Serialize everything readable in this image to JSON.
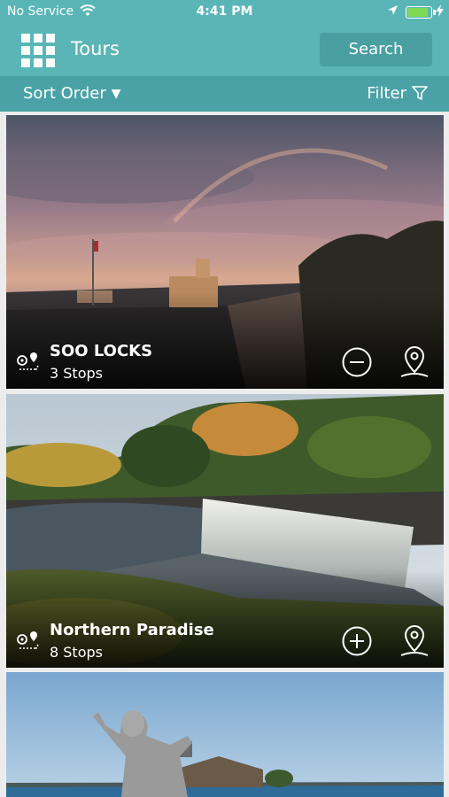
{
  "status_bar": {
    "carrier": "No Service",
    "time": "4:41 PM",
    "battery_level": 0.9,
    "icons": [
      "wifi-icon",
      "location-arrow-icon",
      "battery-icon",
      "charging-bolt-icon"
    ]
  },
  "header": {
    "title": "Tours",
    "search_label": "Search",
    "menu_icon": "grid-menu-icon"
  },
  "toolbar": {
    "sort_label": "Sort Order",
    "filter_label": "Filter"
  },
  "tours": [
    {
      "name": "SOO LOCKS",
      "stops": "3 Stops",
      "action_icon": "minus-circle-icon",
      "map_icon": "map-pin-icon"
    },
    {
      "name": "Northern Paradise",
      "stops": "8 Stops",
      "action_icon": "plus-circle-icon",
      "map_icon": "map-pin-icon"
    },
    {
      "name": "",
      "stops": ""
    }
  ],
  "colors": {
    "header_teal": "#5ab5b7",
    "subbar_teal": "#4aa2a6",
    "search_button": "#4a9fa1"
  }
}
